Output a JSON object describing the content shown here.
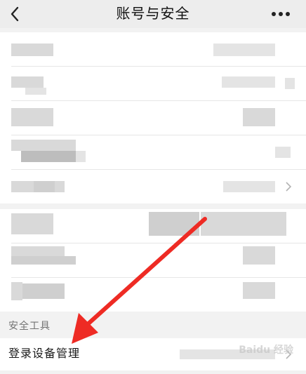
{
  "navbar": {
    "title": "账号与安全",
    "back_icon": "chevron-left-icon",
    "more_icon": "more-dots-icon"
  },
  "sections": {
    "security_tools_header": "安全工具"
  },
  "login_device": {
    "label": "登录设备管理",
    "chevron_icon": "chevron-right-icon"
  },
  "watermark": {
    "text": "Baidu 经验"
  },
  "annotation": {
    "arrow_color": "#ee2b24"
  },
  "colors": {
    "background": "#f2f2f2",
    "row": "#ffffff",
    "arrow": "#ee2b24"
  }
}
